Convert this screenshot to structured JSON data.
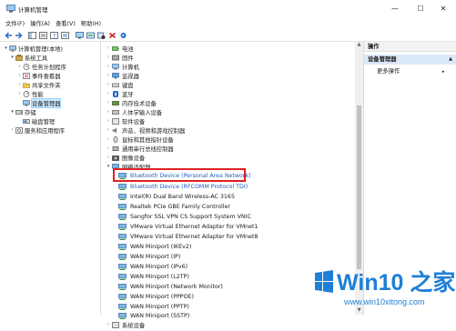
{
  "window": {
    "title": "计算机管理",
    "minimize": "—",
    "maximize": "☐",
    "close": "✕"
  },
  "menu": [
    "文件(F)",
    "操作(A)",
    "查看(V)",
    "帮助(H)"
  ],
  "tree": [
    {
      "label": "计算机管理(本地)",
      "caret": "▾",
      "indent": 0
    },
    {
      "label": "系统工具",
      "caret": "▾",
      "indent": 1
    },
    {
      "label": "任务计划程序",
      "caret": "›",
      "indent": 2
    },
    {
      "label": "事件查看器",
      "caret": "›",
      "indent": 2
    },
    {
      "label": "共享文件夹",
      "caret": "›",
      "indent": 2
    },
    {
      "label": "性能",
      "caret": "›",
      "indent": 2
    },
    {
      "label": "设备管理器",
      "caret": "",
      "indent": 2,
      "selected": true
    },
    {
      "label": "存储",
      "caret": "▾",
      "indent": 1
    },
    {
      "label": "磁盘管理",
      "caret": "",
      "indent": 2
    },
    {
      "label": "服务和应用程序",
      "caret": "›",
      "indent": 1
    }
  ],
  "devices": [
    {
      "label": "电池",
      "caret": "›"
    },
    {
      "label": "固件",
      "caret": "›"
    },
    {
      "label": "计算机",
      "caret": "›"
    },
    {
      "label": "监视器",
      "caret": "›"
    },
    {
      "label": "键盘",
      "caret": "›"
    },
    {
      "label": "蓝牙",
      "caret": "›"
    },
    {
      "label": "内存技术设备",
      "caret": "›"
    },
    {
      "label": "人体学输入设备",
      "caret": "›"
    },
    {
      "label": "软件设备",
      "caret": "›"
    },
    {
      "label": "声音、视频和游戏控制器",
      "caret": "›"
    },
    {
      "label": "鼠标和其他指针设备",
      "caret": "›"
    },
    {
      "label": "通用串行总线控制器",
      "caret": "›"
    },
    {
      "label": "图像设备",
      "caret": "›"
    },
    {
      "label": "网络适配器",
      "caret": "▾"
    }
  ],
  "network_adapters": [
    "Bluetooth Device (Personal Area Network)",
    "Bluetooth Device (RFCOMM Protocol TDI)",
    "Intel(R) Dual Band Wireless-AC 3165",
    "Realtek PCIe GBE Family Controller",
    "Sangfor SSL VPN CS Support System VNIC",
    "VMware Virtual Ethernet Adapter for VMnet1",
    "VMware Virtual Ethernet Adapter for VMnet8",
    "WAN Miniport (IKEv2)",
    "WAN Miniport (IP)",
    "WAN Miniport (IPv6)",
    "WAN Miniport (L2TP)",
    "WAN Miniport (Network Monitor)",
    "WAN Miniport (PPPOE)",
    "WAN Miniport (PPTP)",
    "WAN Miniport (SSTP)"
  ],
  "last_device": {
    "label": "系统设备",
    "caret": "›"
  },
  "actions": {
    "header": "操作",
    "section": "设备管理器",
    "section_arrow": "▲",
    "more": "更多操作",
    "more_arrow": "▸"
  },
  "watermark": {
    "brand": "Win10 之家",
    "url": "www.win10xitong.com"
  },
  "colors": {
    "highlight": "#e02020",
    "selection": "#cce8ff",
    "brand": "#1e7fd6",
    "link_blue": "#1f5fbf"
  }
}
